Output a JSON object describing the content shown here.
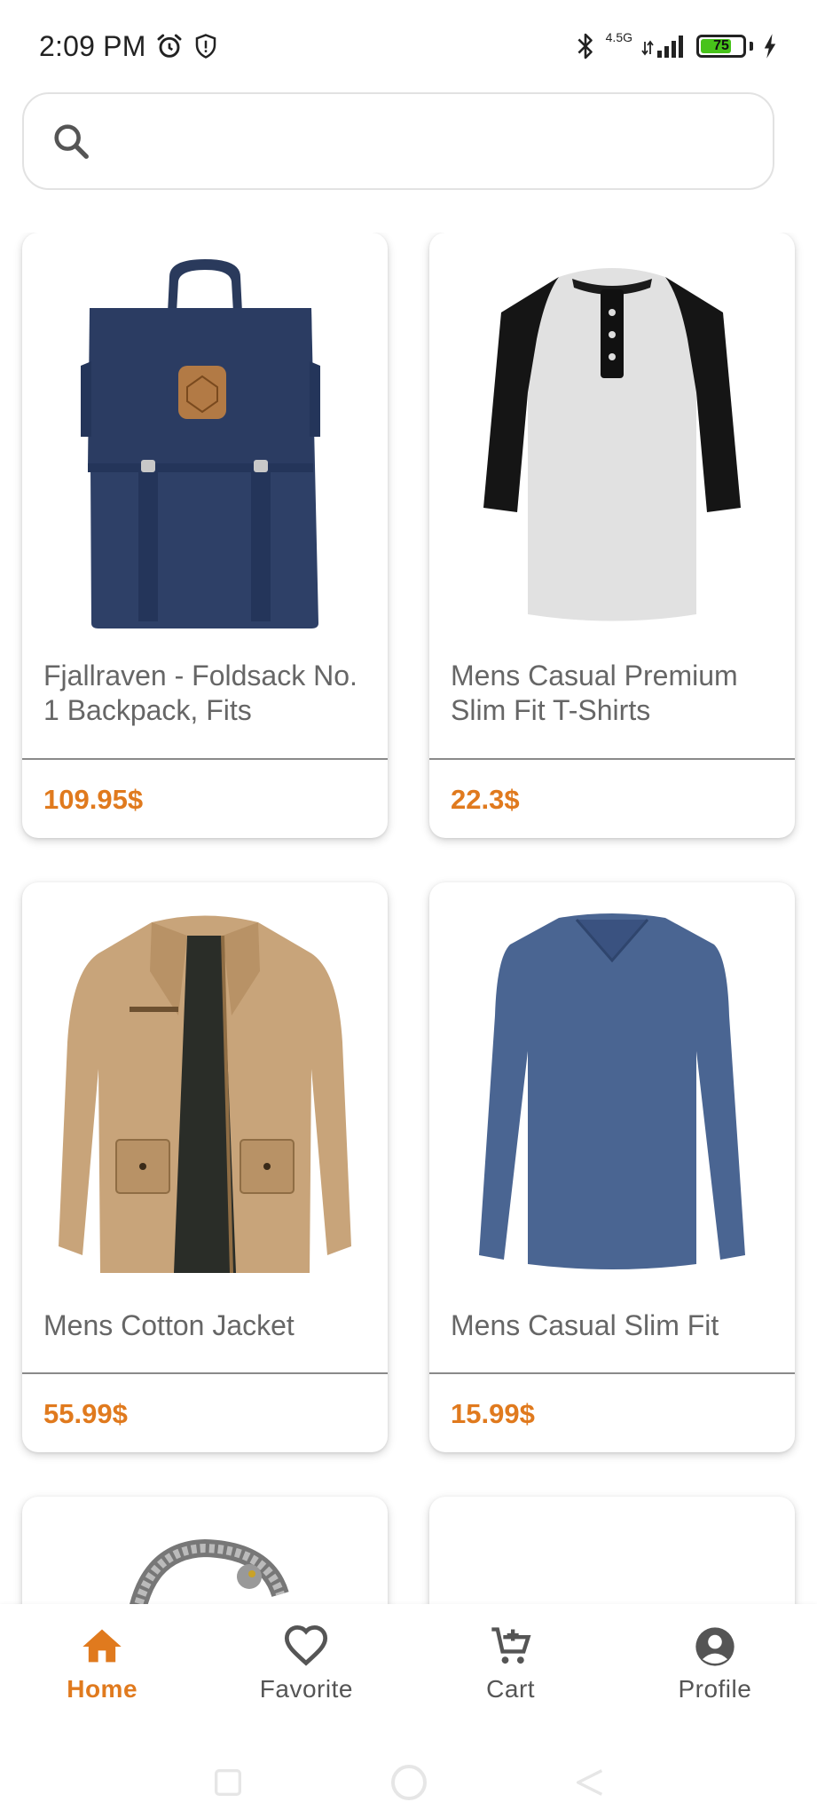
{
  "status_bar": {
    "time": "2:09 PM",
    "network": "4.5G",
    "battery": "75",
    "battery_level": 0.75
  },
  "search": {
    "placeholder": "",
    "value": ""
  },
  "products": [
    {
      "title": "Fjallraven - Foldsack No. 1 Backpack, Fits",
      "price": "109.95$",
      "image": "backpack"
    },
    {
      "title": "Mens Casual Premium Slim Fit T-Shirts",
      "price": "22.3$",
      "image": "raglan-tshirt"
    },
    {
      "title": "Mens Cotton Jacket",
      "price": "55.99$",
      "image": "cotton-jacket"
    },
    {
      "title": "Mens Casual Slim Fit",
      "price": "15.99$",
      "image": "longsleeve-shirt"
    },
    {
      "title": "",
      "price": "",
      "image": "dragon-bracelet"
    },
    {
      "title": "",
      "price": "",
      "image": "blank"
    }
  ],
  "bottom_nav": {
    "items": [
      {
        "label": "Home",
        "icon": "home-icon",
        "active": true
      },
      {
        "label": "Favorite",
        "icon": "heart-icon",
        "active": false
      },
      {
        "label": "Cart",
        "icon": "cart-icon",
        "active": false
      },
      {
        "label": "Profile",
        "icon": "profile-icon",
        "active": false
      }
    ]
  },
  "colors": {
    "accent": "#e07a1e",
    "text_muted": "#666666",
    "battery": "#47c31a"
  }
}
